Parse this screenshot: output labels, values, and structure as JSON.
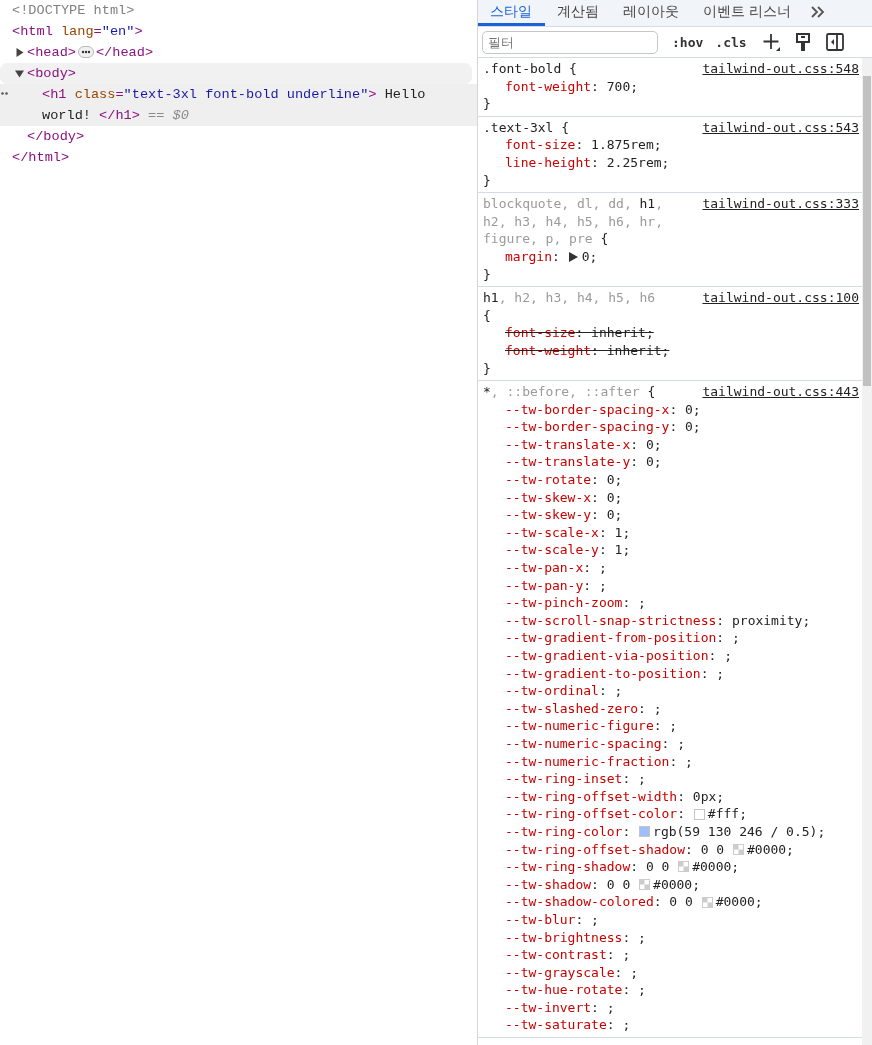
{
  "dom_tree": [
    {
      "open": [
        {
          "kind": "doctype",
          "text": "<!DOCTYPE html>"
        }
      ],
      "hovered": false,
      "selected": false
    },
    {
      "open": [
        {
          "kind": "tag",
          "text": "<html"
        },
        {
          "kind": "attr",
          "text": " lang"
        },
        {
          "kind": "tag",
          "text": "="
        },
        {
          "kind": "value",
          "text": "\"en\""
        },
        {
          "kind": "tag",
          "text": ">"
        }
      ],
      "hovered": false,
      "selected": false,
      "children": [
        {
          "open": [
            {
              "kind": "tag",
              "text": "<head>"
            },
            {
              "kind": "badge"
            },
            {
              "kind": "tag",
              "text": "</head>"
            }
          ],
          "expanded": false,
          "hovered": false,
          "selected": false
        },
        {
          "open": [
            {
              "kind": "tag",
              "text": "<body>"
            }
          ],
          "expanded": true,
          "hovered": true,
          "selected": false,
          "children": [
            {
              "open": [
                {
                  "kind": "tag",
                  "text": "<h1"
                },
                {
                  "kind": "attr",
                  "text": " class"
                },
                {
                  "kind": "tag",
                  "text": "="
                },
                {
                  "kind": "value",
                  "text": "\"text-3xl font-bold underline\""
                },
                {
                  "kind": "tag",
                  "text": ">"
                },
                {
                  "kind": "text",
                  "text": " Hello world! "
                },
                {
                  "kind": "tag",
                  "text": "</h1>"
                },
                {
                  "kind": "ref",
                  "text": " == $0"
                }
              ],
              "hovered": false,
              "selected": true
            }
          ],
          "close": [
            {
              "kind": "tag",
              "text": "</body>"
            }
          ]
        }
      ],
      "close": [
        {
          "kind": "tag",
          "text": "</html>"
        }
      ]
    }
  ],
  "styles_panel": {
    "tabs": [
      {
        "label": "스타일",
        "selected": true
      },
      {
        "label": "계산됨",
        "selected": false
      },
      {
        "label": "레이아웃",
        "selected": false
      },
      {
        "label": "이벤트 리스너",
        "selected": false
      }
    ],
    "filter": {
      "placeholder": "필터"
    },
    "toolbar_buttons": [
      {
        "kind": "text",
        "label": ":hov"
      },
      {
        "kind": "text",
        "label": ".cls"
      },
      {
        "kind": "add"
      },
      {
        "kind": "paint"
      },
      {
        "kind": "sidebar"
      }
    ],
    "rules": [
      {
        "selector": [
          {
            "text": ".font-bold",
            "matched": true
          }
        ],
        "brace": "{",
        "source": "tailwind-out.css:548",
        "declarations": [
          {
            "text": "font-weight: 700;",
            "overridden": false
          }
        ],
        "close": "}"
      },
      {
        "selector": [
          {
            "text": ".text-3xl",
            "matched": true
          }
        ],
        "brace": "{",
        "source": "tailwind-out.css:543",
        "declarations": [
          {
            "text": "font-size: 1.875rem;",
            "overridden": false
          },
          {
            "text": "line-height: 2.25rem;",
            "overridden": false
          }
        ],
        "close": "}"
      },
      {
        "selector": [
          {
            "text": "blockquote, dl, dd, ",
            "matched": false
          },
          {
            "text": "h1",
            "matched": true
          },
          {
            "text": ", h2, h3, h4, h5, h6, hr, figure, p, pre",
            "matched": false
          }
        ],
        "brace": "{",
        "source": "tailwind-out.css:333",
        "declarations": [
          {
            "text": "margin: ",
            "expander": true,
            "after": "0;",
            "overridden": false
          }
        ],
        "close": "}"
      },
      {
        "selector": [
          {
            "text": "h1",
            "matched": true
          },
          {
            "text": ", h2, h3, h4, h5, h6",
            "matched": false
          }
        ],
        "brace": "{",
        "brace_break": true,
        "source": "tailwind-out.css:100",
        "declarations": [
          {
            "text": "font-size: inherit;",
            "overridden": true
          },
          {
            "text": "font-weight: inherit;",
            "overridden": true
          }
        ],
        "close": "}"
      },
      {
        "selector": [
          {
            "text": "*",
            "matched": true
          },
          {
            "text": ", ::before, ::after",
            "matched": false
          }
        ],
        "brace": "{",
        "source": "tailwind-out.css:443",
        "declarations": [
          {
            "text": "--tw-border-spacing-x: 0;",
            "overridden": false
          },
          {
            "text": "--tw-border-spacing-y: 0;",
            "overridden": false
          },
          {
            "text": "--tw-translate-x: 0;",
            "overridden": false
          },
          {
            "text": "--tw-translate-y: 0;",
            "overridden": false
          },
          {
            "text": "--tw-rotate: 0;",
            "overridden": false
          },
          {
            "text": "--tw-skew-x: 0;",
            "overridden": false
          },
          {
            "text": "--tw-skew-y: 0;",
            "overridden": false
          },
          {
            "text": "--tw-scale-x: 1;",
            "overridden": false
          },
          {
            "text": "--tw-scale-y: 1;",
            "overridden": false
          },
          {
            "text": "--tw-pan-x: ;",
            "overridden": false
          },
          {
            "text": "--tw-pan-y: ;",
            "overridden": false
          },
          {
            "text": "--tw-pinch-zoom: ;",
            "overridden": false
          },
          {
            "text": "--tw-scroll-snap-strictness: proximity;",
            "overridden": false
          },
          {
            "text": "--tw-gradient-from-position: ;",
            "overridden": false
          },
          {
            "text": "--tw-gradient-via-position: ;",
            "overridden": false
          },
          {
            "text": "--tw-gradient-to-position: ;",
            "overridden": false
          },
          {
            "text": "--tw-ordinal: ;",
            "overridden": false
          },
          {
            "text": "--tw-slashed-zero: ;",
            "overridden": false
          },
          {
            "text": "--tw-numeric-figure: ;",
            "overridden": false
          },
          {
            "text": "--tw-numeric-spacing: ;",
            "overridden": false
          },
          {
            "text": "--tw-numeric-fraction: ;",
            "overridden": false
          },
          {
            "text": "--tw-ring-inset: ;",
            "overridden": false
          },
          {
            "text": "--tw-ring-offset-width: 0px;",
            "overridden": false
          },
          {
            "text": "--tw-ring-offset-color: ",
            "swatch": {
              "kind": "solid",
              "color": "#ffffff"
            },
            "after": "#fff;",
            "overridden": false
          },
          {
            "text": "--tw-ring-color: ",
            "swatch": {
              "kind": "solid",
              "color": "#9dc0fa"
            },
            "after": "rgb(59 130 246 / 0.5);",
            "overridden": false
          },
          {
            "text": "--tw-ring-offset-shadow: 0 0 ",
            "swatch": {
              "kind": "transparent"
            },
            "after": "#0000;",
            "overridden": false
          },
          {
            "text": "--tw-ring-shadow: 0 0 ",
            "swatch": {
              "kind": "transparent"
            },
            "after": "#0000;",
            "overridden": false
          },
          {
            "text": "--tw-shadow: 0 0 ",
            "swatch": {
              "kind": "transparent"
            },
            "after": "#0000;",
            "overridden": false
          },
          {
            "text": "--tw-shadow-colored: 0 0 ",
            "swatch": {
              "kind": "transparent"
            },
            "after": "#0000;",
            "overridden": false
          },
          {
            "text": "--tw-blur: ;",
            "overridden": false
          },
          {
            "text": "--tw-brightness: ;",
            "overridden": false
          },
          {
            "text": "--tw-contrast: ;",
            "overridden": false
          },
          {
            "text": "--tw-grayscale: ;",
            "overridden": false
          },
          {
            "text": "--tw-hue-rotate: ;",
            "overridden": false
          },
          {
            "text": "--tw-invert: ;",
            "overridden": false
          },
          {
            "text": "--tw-saturate: ;",
            "overridden": false
          }
        ]
      }
    ]
  }
}
